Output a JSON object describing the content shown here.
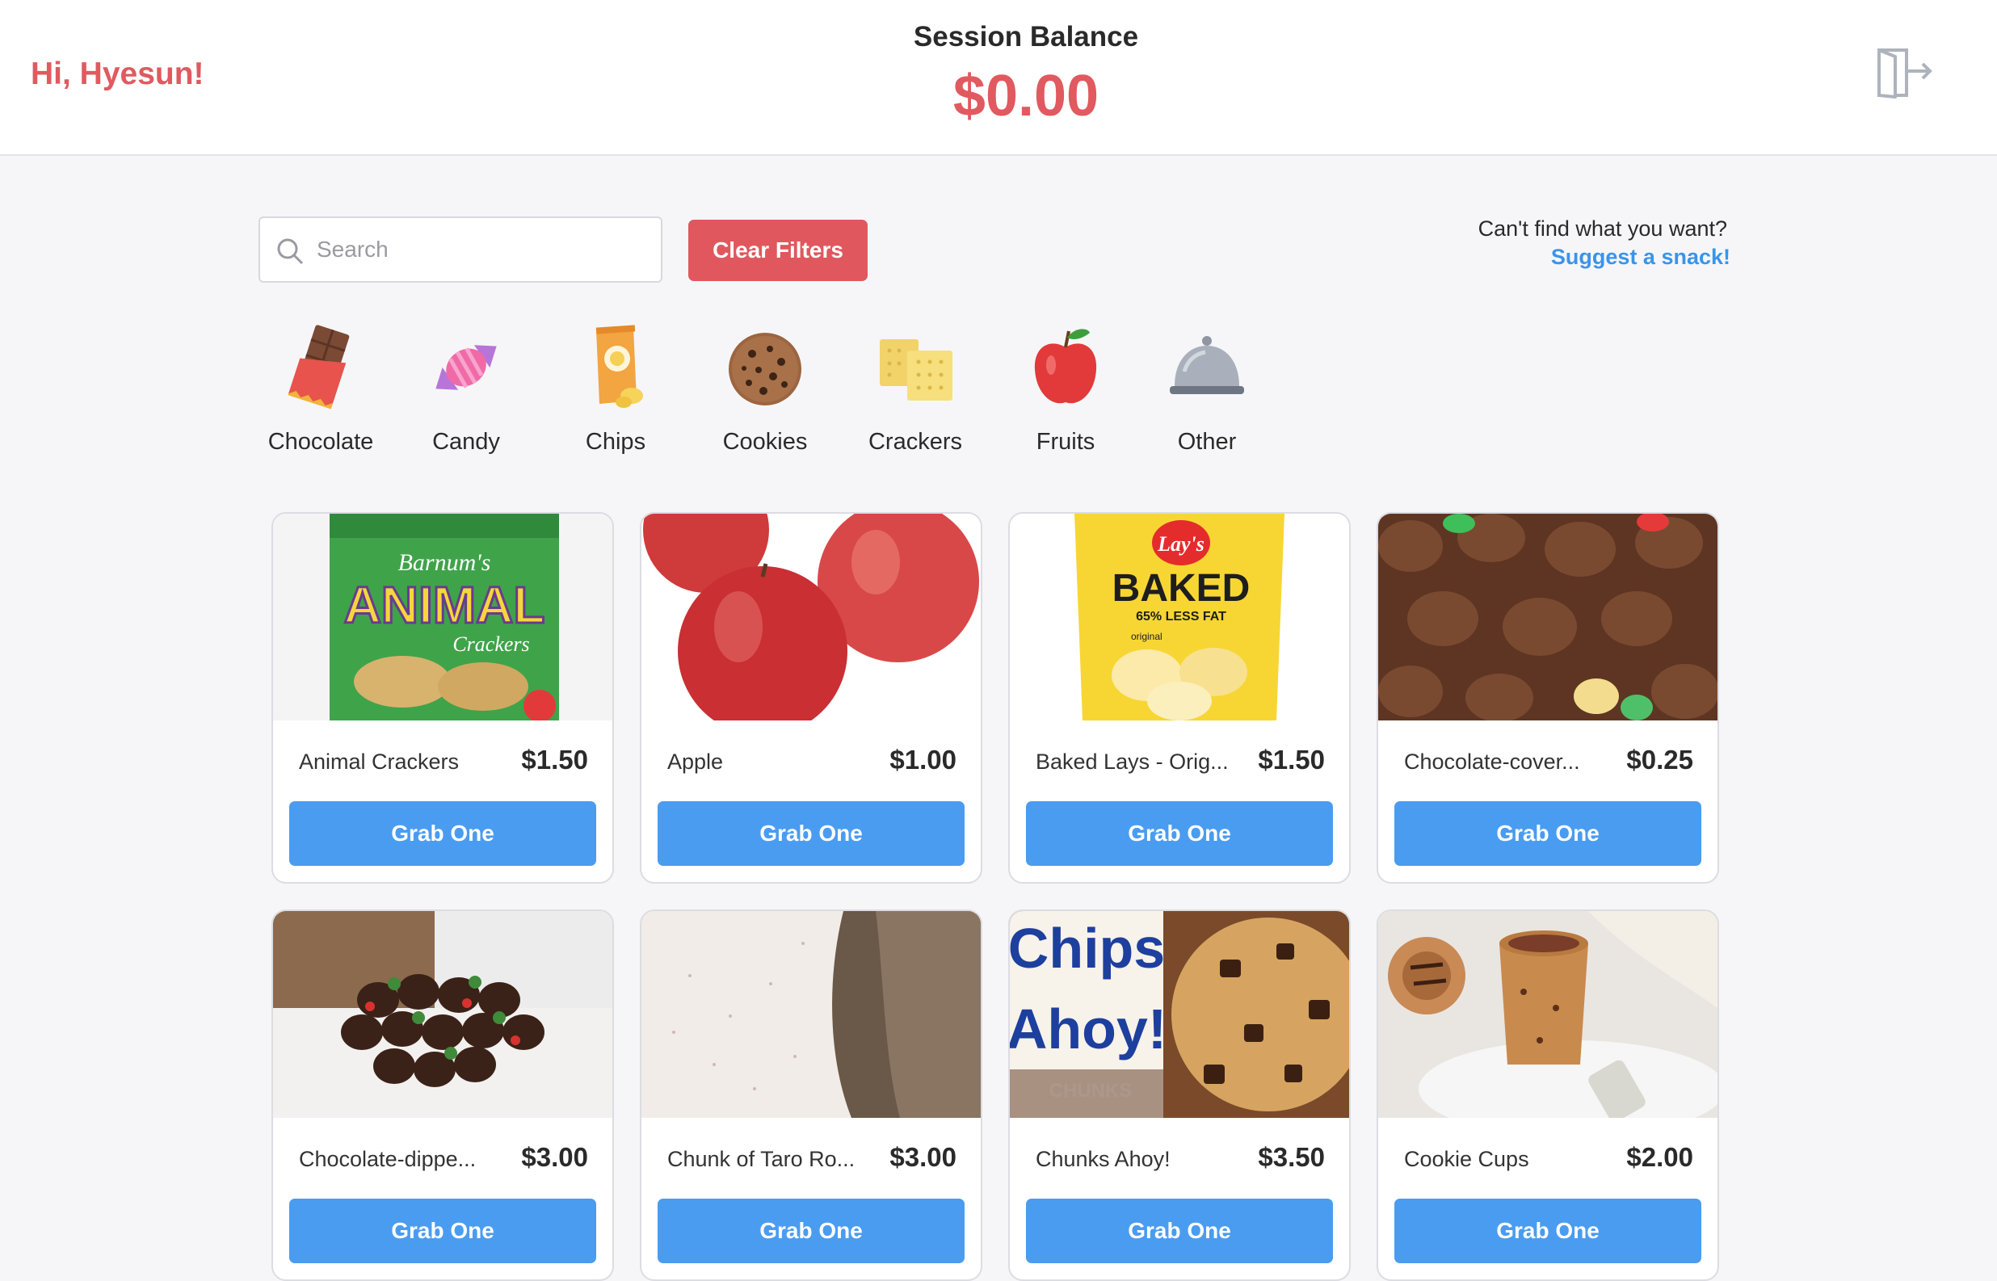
{
  "header": {
    "greeting": "Hi, Hyesun!",
    "balance_label": "Session Balance",
    "balance_value": "$0.00",
    "exit_icon": "exit-door-icon"
  },
  "filters": {
    "search_placeholder": "Search",
    "clear_label": "Clear Filters",
    "suggest_question": "Can't find what you want?",
    "suggest_link": "Suggest a snack!"
  },
  "categories": [
    {
      "label": "Chocolate",
      "icon": "chocolate-bar-icon"
    },
    {
      "label": "Candy",
      "icon": "candy-icon"
    },
    {
      "label": "Chips",
      "icon": "chips-bag-icon"
    },
    {
      "label": "Cookies",
      "icon": "cookie-icon"
    },
    {
      "label": "Crackers",
      "icon": "crackers-icon"
    },
    {
      "label": "Fruits",
      "icon": "apple-icon"
    },
    {
      "label": "Other",
      "icon": "cloche-icon"
    }
  ],
  "products": [
    {
      "name": "Animal Crackers",
      "price": "$1.50",
      "button": "Grab One"
    },
    {
      "name": "Apple",
      "price": "$1.00",
      "button": "Grab One"
    },
    {
      "name": "Baked Lays - Orig...",
      "price": "$1.50",
      "button": "Grab One"
    },
    {
      "name": "Chocolate-cover...",
      "price": "$0.25",
      "button": "Grab One"
    },
    {
      "name": "Chocolate-dippe...",
      "price": "$3.00",
      "button": "Grab One"
    },
    {
      "name": "Chunk of Taro Ro...",
      "price": "$3.00",
      "button": "Grab One"
    },
    {
      "name": "Chunks Ahoy!",
      "price": "$3.50",
      "button": "Grab One"
    },
    {
      "name": "Cookie Cups",
      "price": "$2.00",
      "button": "Grab One"
    }
  ],
  "image_text": {
    "animal_crackers_brand": "Barnum's",
    "animal_crackers_logo": "ANIMAL",
    "animal_crackers_sub": "Crackers",
    "lays_brand": "Lay's",
    "lays_baked": "BAKED",
    "lays_less_fat": "65% LESS FAT",
    "lays_original": "original",
    "chips_ahoy_top": "Chips",
    "chips_ahoy_bottom": "Ahoy!",
    "chips_ahoy_chunks": "CHUNKS"
  },
  "colors": {
    "accent_red": "#e05a5f",
    "button_blue": "#4a9cf0",
    "link_blue": "#3a94ea"
  }
}
